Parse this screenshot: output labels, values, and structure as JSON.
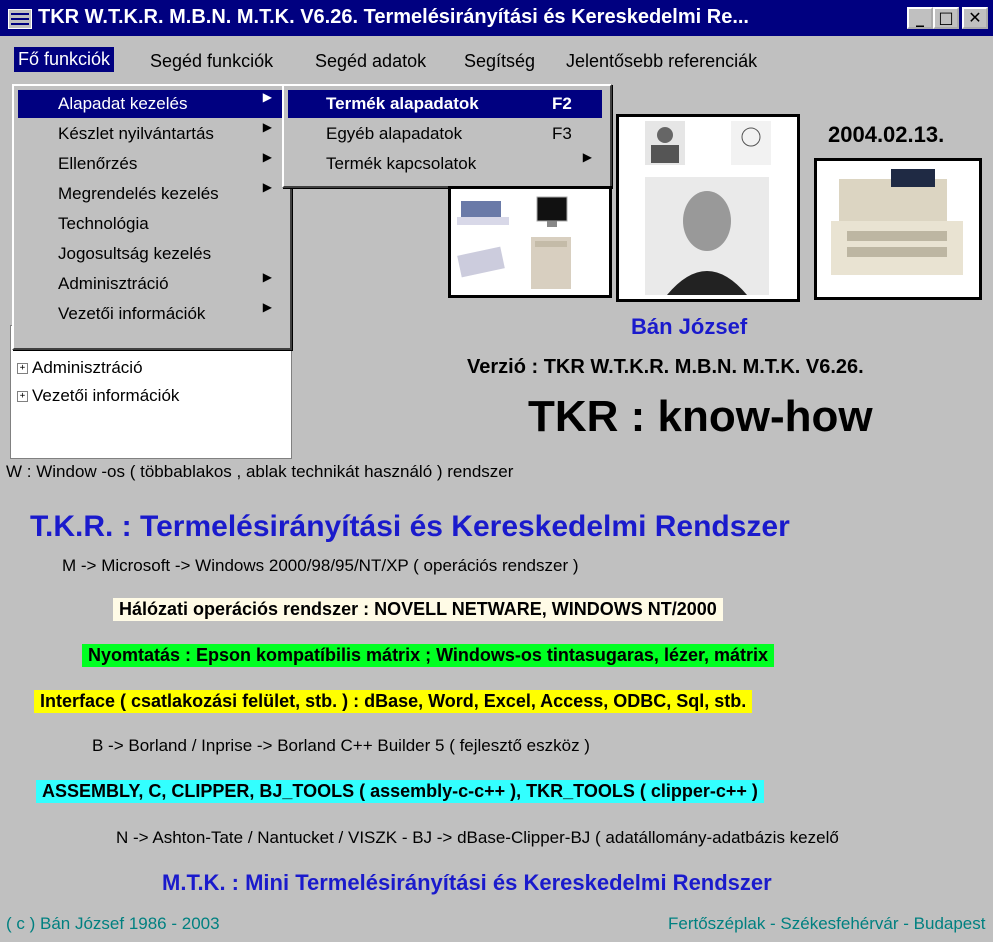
{
  "window": {
    "title": "TKR W.T.K.R. M.B.N. M.T.K. V6.26. Termelésirányítási és Kereskedelmi Re...",
    "min": "_",
    "max": "□",
    "close": "✕"
  },
  "menubar": {
    "items": [
      "Fő funkciók",
      "Segéd funkciók",
      "Segéd adatok",
      "Segítség",
      "Jelentősebb referenciák"
    ]
  },
  "main_menu": {
    "items": [
      {
        "label": "Alapadat kezelés",
        "submenu": true,
        "highlighted": true
      },
      {
        "label": "Készlet nyilvántartás",
        "submenu": true
      },
      {
        "label": "Ellenőrzés",
        "submenu": true
      },
      {
        "label": "Megrendelés kezelés",
        "submenu": true
      },
      {
        "label": "Technológia",
        "submenu": false
      },
      {
        "label": "Jogosultság kezelés",
        "submenu": false
      },
      {
        "label": "Adminisztráció",
        "submenu": true
      },
      {
        "label": "Vezetői információk",
        "submenu": true
      }
    ]
  },
  "sub_menu": {
    "items": [
      {
        "label": "Termék alapadatok",
        "shortcut": "F2",
        "highlighted": true
      },
      {
        "label": "Egyéb alapadatok",
        "shortcut": "F3"
      },
      {
        "label": "Termék kapcsolatok",
        "shortcut": "",
        "submenu": true
      }
    ]
  },
  "tree": {
    "items": [
      "Adminisztráció",
      "Vezetői információk"
    ]
  },
  "date": "2004.02.13.",
  "person_name": "Bán József",
  "version": "Verzió : TKR W.T.K.R. M.B.N. M.T.K. V6.26.",
  "knowhow": "TKR :  know-how",
  "lines": {
    "w": "W : Window -os ( többablakos , ablak technikát használó ) rendszer",
    "tkr": "T.K.R. : Termelésirányítási és Kereskedelmi Rendszer",
    "m": "M -> Microsoft -> Windows 2000/98/95/NT/XP      ( operációs rendszer )",
    "network": "Hálózati operációs rendszer : NOVELL NETWARE, WINDOWS NT/2000",
    "print": "Nyomtatás : Epson kompatíbilis mátrix ;  Windows-os tintasugaras, lézer, mátrix",
    "interface": "Interface ( csatlakozási felület, stb. )  : dBase, Word, Excel, Access, ODBC, Sql, stb.",
    "b": "B -> Borland / Inprise -> Borland C++ Builder 5      ( fejlesztő eszköz )",
    "assembly": "ASSEMBLY, C, CLIPPER, BJ_TOOLS ( assembly-c-c++ ), TKR_TOOLS ( clipper-c++ )",
    "n": "N -> Ashton-Tate / Nantucket / VISZK - BJ -> dBase-Clipper-BJ    ( adatállomány-adatbázis kezelő",
    "mtk": "M.T.K.  : Mini Termelésirányítási és Kereskedelmi Rendszer",
    "copyright": "( c ) Bán József 1986 - 2003",
    "places": "Fertőszéplak - Székesfehérvár - Budapest"
  },
  "colors": {
    "title_bg": "#000080",
    "menu_hl": "#000080",
    "blue_text": "#1a1acc",
    "cream_bg": "#fffbe6",
    "green_bg": "#00ff22",
    "yellow_bg": "#ffff00",
    "cyan_bg": "#33ffff",
    "footer_text": "#008080"
  }
}
